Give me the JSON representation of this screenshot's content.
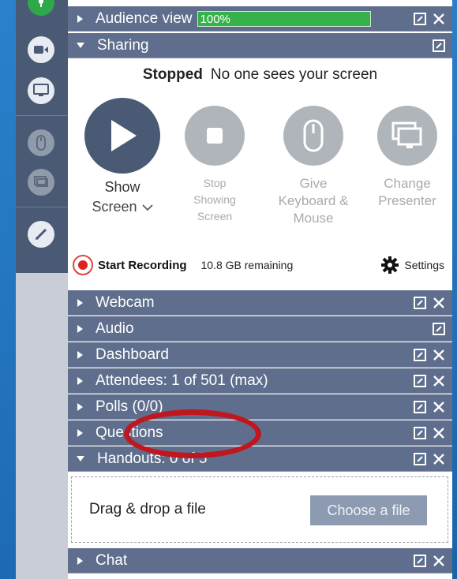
{
  "toolbar": {
    "buttons": [
      {
        "icon": "mic-icon"
      },
      {
        "icon": "webcam-icon"
      },
      {
        "icon": "screen-share-icon"
      },
      {
        "icon": "mouse-icon"
      },
      {
        "icon": "presenter-icon"
      },
      {
        "icon": "pencil-icon"
      }
    ]
  },
  "audience": {
    "label": "Audience view",
    "percent_text": "100%",
    "percent": 100
  },
  "sharing": {
    "label": "Sharing",
    "status_strong": "Stopped",
    "status_text": "No one sees your screen",
    "show_label": "Show",
    "screen_select": "Screen",
    "stop_line1": "Stop",
    "stop_line2": "Showing",
    "stop_line3": "Screen",
    "give_line1": "Give",
    "give_line2": "Keyboard &",
    "give_line3": "Mouse",
    "change_line1": "Change",
    "change_line2": "Presenter",
    "record_label": "Start Recording",
    "remaining": "10.8 GB remaining",
    "settings_label": "Settings"
  },
  "panels": {
    "webcam": "Webcam",
    "audio": "Audio",
    "dashboard": "Dashboard",
    "attendees": "Attendees: 1 of 501 (max)",
    "polls": "Polls (0/0)",
    "questions": "Questions",
    "handouts": "Handouts: 0 of 5",
    "chat": "Chat"
  },
  "handouts": {
    "drop_text": "Drag & drop a file",
    "choose_button": "Choose a file"
  },
  "colors": {
    "bar": "#5e6e8c",
    "accent_green": "#35b34a",
    "annotation_red": "#c0161e"
  }
}
